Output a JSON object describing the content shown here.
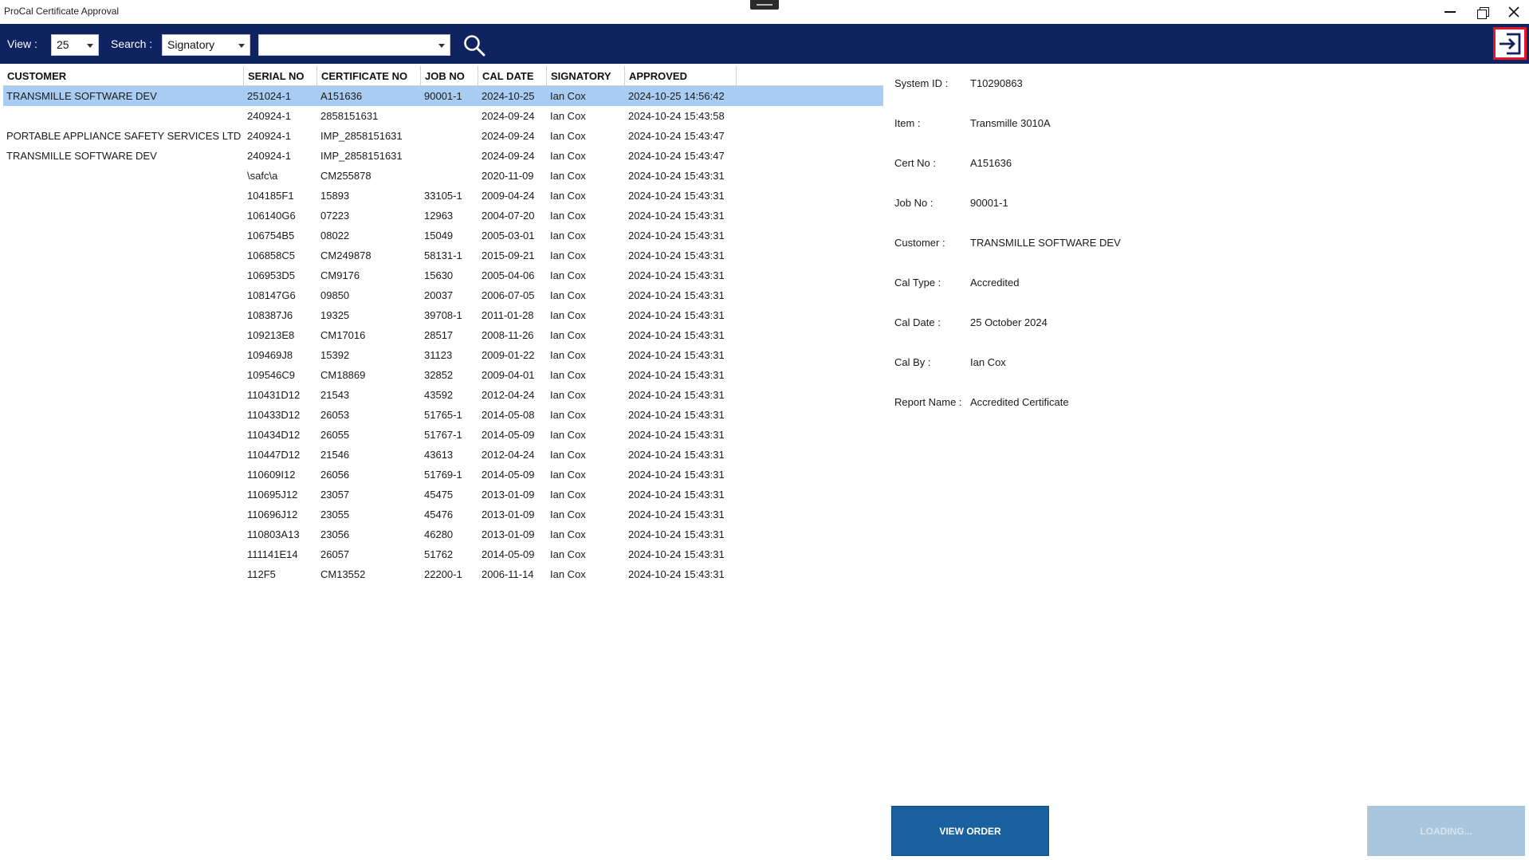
{
  "window": {
    "title": "ProCal Certificate Approval"
  },
  "toolbar": {
    "view_label": "View :",
    "view_value": "25",
    "search_label": "Search :",
    "search_field_value": "Signatory",
    "search_text_value": "",
    "search_icon": "search-icon",
    "exit_icon": "sign-in-arrow-icon"
  },
  "table": {
    "columns": [
      "CUSTOMER",
      "SERIAL NO",
      "CERTIFICATE NO",
      "JOB NO",
      "CAL DATE",
      "SIGNATORY",
      "APPROVED"
    ],
    "selected_index": 0,
    "rows": [
      [
        "TRANSMILLE SOFTWARE DEV",
        "251024-1",
        "A151636",
        "90001-1",
        "2024-10-25",
        "Ian Cox",
        "2024-10-25 14:56:42"
      ],
      [
        "",
        "240924-1",
        "2858151631",
        "",
        "2024-09-24",
        "Ian Cox",
        "2024-10-24 15:43:58"
      ],
      [
        "PORTABLE APPLIANCE SAFETY SERVICES LTD",
        "240924-1",
        "IMP_2858151631",
        "",
        "2024-09-24",
        "Ian Cox",
        "2024-10-24 15:43:47"
      ],
      [
        "TRANSMILLE SOFTWARE DEV",
        "240924-1",
        "IMP_2858151631",
        "",
        "2024-09-24",
        "Ian Cox",
        "2024-10-24 15:43:47"
      ],
      [
        "",
        "\\safc\\a",
        "CM255878",
        "",
        "2020-11-09",
        "Ian Cox",
        "2024-10-24 15:43:31"
      ],
      [
        "",
        "104185F1",
        "15893",
        "33105-1",
        "2009-04-24",
        "Ian Cox",
        "2024-10-24 15:43:31"
      ],
      [
        "",
        "106140G6",
        "07223",
        "12963",
        "2004-07-20",
        "Ian Cox",
        "2024-10-24 15:43:31"
      ],
      [
        "",
        "106754B5",
        "08022",
        "15049",
        "2005-03-01",
        "Ian Cox",
        "2024-10-24 15:43:31"
      ],
      [
        "",
        "106858C5",
        "CM249878",
        "58131-1",
        "2015-09-21",
        "Ian Cox",
        "2024-10-24 15:43:31"
      ],
      [
        "",
        "106953D5",
        "CM9176",
        "15630",
        "2005-04-06",
        "Ian Cox",
        "2024-10-24 15:43:31"
      ],
      [
        "",
        "108147G6",
        "09850",
        "20037",
        "2006-07-05",
        "Ian Cox",
        "2024-10-24 15:43:31"
      ],
      [
        "",
        "108387J6",
        "19325",
        "39708-1",
        "2011-01-28",
        "Ian Cox",
        "2024-10-24 15:43:31"
      ],
      [
        "",
        "109213E8",
        "CM17016",
        "28517",
        "2008-11-26",
        "Ian Cox",
        "2024-10-24 15:43:31"
      ],
      [
        "",
        "109469J8",
        "15392",
        "31123",
        "2009-01-22",
        "Ian Cox",
        "2024-10-24 15:43:31"
      ],
      [
        "",
        "109546C9",
        "CM18869",
        "32852",
        "2009-04-01",
        "Ian Cox",
        "2024-10-24 15:43:31"
      ],
      [
        "",
        "110431D12",
        "21543",
        "43592",
        "2012-04-24",
        "Ian Cox",
        "2024-10-24 15:43:31"
      ],
      [
        "",
        "110433D12",
        "26053",
        "51765-1",
        "2014-05-08",
        "Ian Cox",
        "2024-10-24 15:43:31"
      ],
      [
        "",
        "110434D12",
        "26055",
        "51767-1",
        "2014-05-09",
        "Ian Cox",
        "2024-10-24 15:43:31"
      ],
      [
        "",
        "110447D12",
        "21546",
        "43613",
        "2012-04-24",
        "Ian Cox",
        "2024-10-24 15:43:31"
      ],
      [
        "",
        "110609I12",
        "26056",
        "51769-1",
        "2014-05-09",
        "Ian Cox",
        "2024-10-24 15:43:31"
      ],
      [
        "",
        "110695J12",
        "23057",
        "45475",
        "2013-01-09",
        "Ian Cox",
        "2024-10-24 15:43:31"
      ],
      [
        "",
        "110696J12",
        "23055",
        "45476",
        "2013-01-09",
        "Ian Cox",
        "2024-10-24 15:43:31"
      ],
      [
        "",
        "110803A13",
        "23056",
        "46280",
        "2013-01-09",
        "Ian Cox",
        "2024-10-24 15:43:31"
      ],
      [
        "",
        "111141E14",
        "26057",
        "51762",
        "2014-05-09",
        "Ian Cox",
        "2024-10-24 15:43:31"
      ],
      [
        "",
        "112F5",
        "CM13552",
        "22200-1",
        "2006-11-14",
        "Ian Cox",
        "2024-10-24 15:43:31"
      ]
    ]
  },
  "details": [
    {
      "label": "System ID :",
      "value": "T10290863"
    },
    {
      "label": "Item :",
      "value": "Transmille 3010A"
    },
    {
      "label": "Cert No :",
      "value": "A151636"
    },
    {
      "label": "Job No :",
      "value": "90001-1"
    },
    {
      "label": "Customer :",
      "value": "TRANSMILLE SOFTWARE DEV"
    },
    {
      "label": "Cal Type :",
      "value": "Accredited"
    },
    {
      "label": "Cal Date :",
      "value": "25 October 2024"
    },
    {
      "label": "Cal By :",
      "value": "Ian Cox"
    },
    {
      "label": "Report Name :",
      "value": "Accredited Certificate"
    }
  ],
  "buttons": {
    "view_order": "VIEW ORDER",
    "loading": "LOADING..."
  },
  "colors": {
    "toolbar_bg": "#0f2361",
    "selected_row": "#a9cdf2",
    "primary_button": "#19609f",
    "disabled_button": "#a9c6dd",
    "exit_border": "#e3162d"
  }
}
